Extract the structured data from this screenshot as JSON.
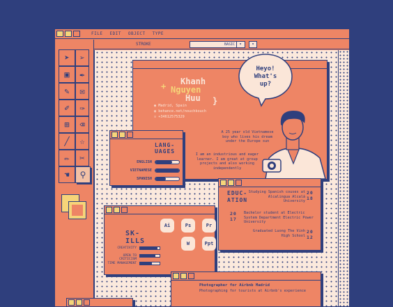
{
  "menu": {
    "items": [
      "FILE",
      "EDIT",
      "OBJECT",
      "TYPE"
    ]
  },
  "strokebar": {
    "label": "STROKE",
    "select_value": "BASIC"
  },
  "profile": {
    "name_line1": "Khanh",
    "name_line2": "Nguyen",
    "name_line3": "Huu",
    "location": "Madrid, Spain",
    "website": "behance.net/nouchkouch",
    "phone": "+34612575329",
    "bubble": "Heyo! What's up?",
    "bio1": "A 25 year old Vietnamese boy who lives his dream under the Europe sun",
    "bio2": "I am an industrious and eager learner. I am great at group projects and also working independently"
  },
  "languages": {
    "title": "LANG-UAGES",
    "items": [
      {
        "label": "ENGLISH",
        "level": 0.7
      },
      {
        "label": "VIETNAMESE",
        "level": 1.0
      },
      {
        "label": "SPANISH",
        "level": 0.45
      }
    ]
  },
  "education": {
    "title": "EDUC-ATION",
    "items": [
      {
        "text": "Studying Spanish couses at Alcalingua Alcalá University",
        "year": "20 18"
      },
      {
        "text": "Bachelor student at Electric System Department Electric Power University",
        "year": "20 17"
      },
      {
        "text": "Graduated Luong The Vinh High School",
        "year": "20 12"
      }
    ]
  },
  "skills": {
    "title": "SK-ILLS",
    "apps": [
      "Ai",
      "Ps",
      "Pr",
      "W",
      "Ppt"
    ],
    "soft": [
      {
        "label": "CREATIVITY",
        "level": 0.9
      },
      {
        "label": "OPEN TO CRITICISM",
        "level": 0.8
      },
      {
        "label": "TIME MANAGEMENT",
        "level": 0.6
      }
    ]
  },
  "experience": {
    "title": "Photographer for Airbnb Madrid",
    "desc": "Photographing for tourists at Airbnb's experience"
  },
  "colors": {
    "navy": "#2f3f7d",
    "coral": "#ee8565",
    "cream": "#fbe9dd",
    "yellow": "#f6d479"
  }
}
